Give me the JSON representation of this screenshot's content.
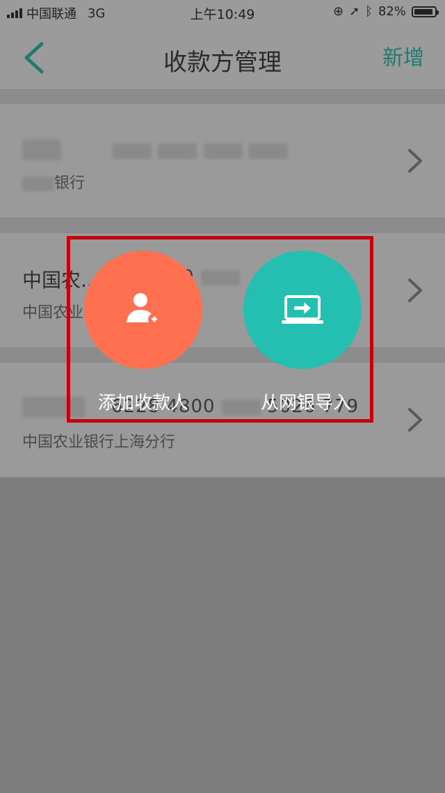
{
  "status_bar": {
    "carrier": "中国联通",
    "network": "3G",
    "time": "上午10:49",
    "battery": "82%"
  },
  "nav": {
    "title": "收款方管理",
    "add_label": "新增"
  },
  "payees": [
    {
      "name": "",
      "number": "",
      "bank": "银行"
    },
    {
      "name": "中国农...",
      "number": "0 ",
      "bank": "中国农业"
    },
    {
      "name": "",
      "number": "6228 4800",
      "number_tail": "5026 779",
      "bank": "中国农业银行上海分行"
    }
  ],
  "actions": [
    {
      "label": "添加收款人",
      "color": "#ff7050",
      "icon": "add-user-icon"
    },
    {
      "label": "从网银导入",
      "color": "#24bfb0",
      "icon": "laptop-import-icon"
    }
  ],
  "colors": {
    "accent": "#1f7a6f",
    "highlight_border": "#c3000b"
  }
}
